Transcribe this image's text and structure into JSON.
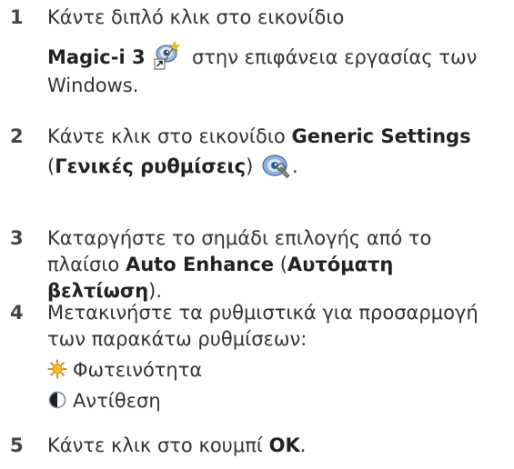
{
  "steps": [
    {
      "number": "1",
      "line1": "Κάντε διπλό κλικ στο εικονίδιο",
      "bold1": "Magic-i 3",
      "line2_rest": " στην επιφάνεια εργασίας των",
      "line3": "Windows.",
      "icon": "magic-i-3-shortcut-icon"
    },
    {
      "number": "2",
      "text1": "Κάντε κλικ στο εικονίδιο ",
      "bold1": "Generic Settings",
      "paren_open": "(",
      "bold2": "Γενικές ρυθμίσεις",
      "paren_close": ")",
      "icon": "generic-settings-icon"
    },
    {
      "number": "3",
      "line1": "Καταργήστε το σημάδι επιλογής από το",
      "text2": "πλαίσιο ",
      "bold1": "Auto Enhance",
      "text3": " (",
      "bold2": "Αυτόματη",
      "bold3": "βελτίωση",
      "text4": ")."
    },
    {
      "number": "4",
      "line1": "Μετακινήστε τα ρυθμιστικά για προσαρμογή",
      "line2": "των παρακάτω ρυθμίσεων:",
      "items": [
        {
          "label": "Φωτεινότητα",
          "icon": "brightness-icon"
        },
        {
          "label": "Αντίθεση",
          "icon": "contrast-icon"
        }
      ]
    },
    {
      "number": "5",
      "text1": "Κάντε κλικ στο κουμπί ",
      "bold1": "OK",
      "text2": "."
    }
  ]
}
